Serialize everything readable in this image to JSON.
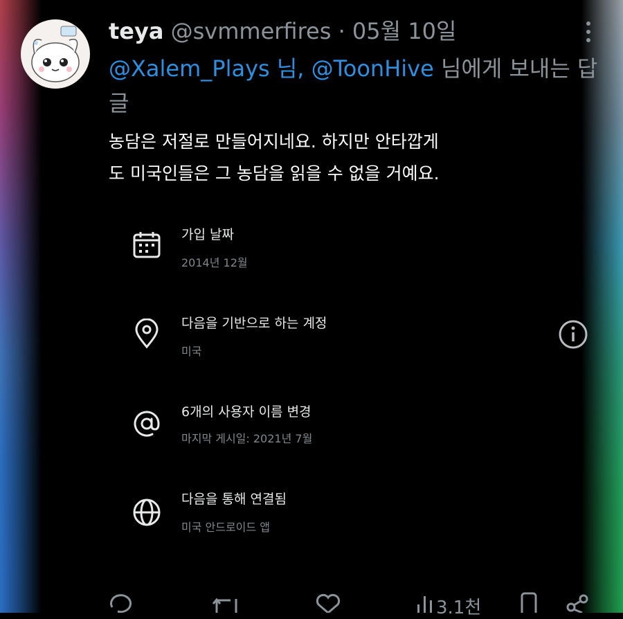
{
  "tweet": {
    "display_name": "teya",
    "handle": "@svmmerfires",
    "separator": "·",
    "date": "05월 10일",
    "reply_to": {
      "mention1": "@Xalem_Plays 님,",
      "mention2": "@ToonHive",
      "suffix": "님에게 보내는 답글"
    },
    "body_line1": "농담은 저절로 만들어지네요. 하지만 안타깝게",
    "body_line2": "도 미국인들은 그 농담을 읽을 수 없을 거예요."
  },
  "about": {
    "joined_title": "가입 날짜",
    "joined_value": "2014년 12월",
    "based_title": "다음을 기반으로 하는 계정",
    "based_value": "미국",
    "username_title": "6개의 사용자 이름 변경",
    "username_value": "마지막 게시일: 2021년 7월",
    "connected_title": "다음을 통해 연결됨",
    "connected_value": "미국 안드로이드 앱"
  },
  "actions": {
    "views": "3.1천"
  },
  "icons": {
    "more": "more-vertical-icon",
    "calendar": "calendar-icon",
    "location": "location-pin-icon",
    "at": "at-sign-icon",
    "globe": "globe-icon",
    "info": "info-icon",
    "reply": "reply-icon",
    "retweet": "retweet-icon",
    "like": "heart-icon",
    "views": "bar-chart-icon",
    "bookmark": "bookmark-icon",
    "share": "share-icon"
  },
  "colors": {
    "background": "#000000",
    "link": "#2d8fe0",
    "secondary_text": "#8b939b",
    "primary_text": "#ffffff"
  }
}
